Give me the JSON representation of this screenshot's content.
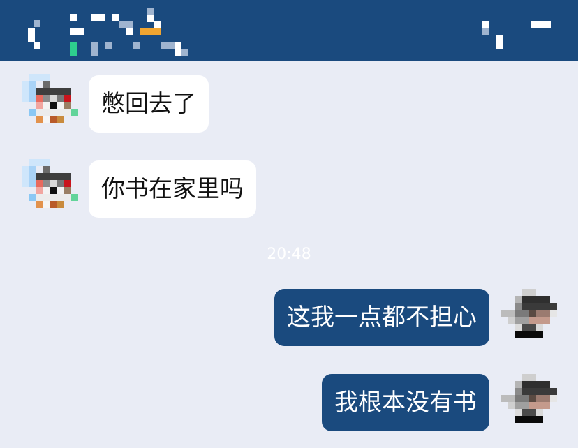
{
  "header": {
    "title": "",
    "status": "",
    "menu": "",
    "colors": {
      "bar": "#1a4a7e"
    }
  },
  "chat": {
    "messages": [
      {
        "side": "incoming",
        "text": "憋回去了"
      },
      {
        "side": "incoming",
        "text": "你书在家里吗"
      },
      {
        "type": "time",
        "text": "20:48"
      },
      {
        "side": "outgoing",
        "text": "这我一点都不担心"
      },
      {
        "side": "outgoing",
        "text": "我根本没有书"
      }
    ]
  },
  "colors": {
    "background": "#e9ecf5",
    "incoming_bubble": "#ffffff",
    "outgoing_bubble": "#1a4a7e",
    "timestamp": "#ffffff"
  },
  "icons": {
    "back": "back-arrow-icon",
    "menu": "menu-icon",
    "contact_avatar": "contact-avatar",
    "self_avatar": "self-avatar"
  }
}
